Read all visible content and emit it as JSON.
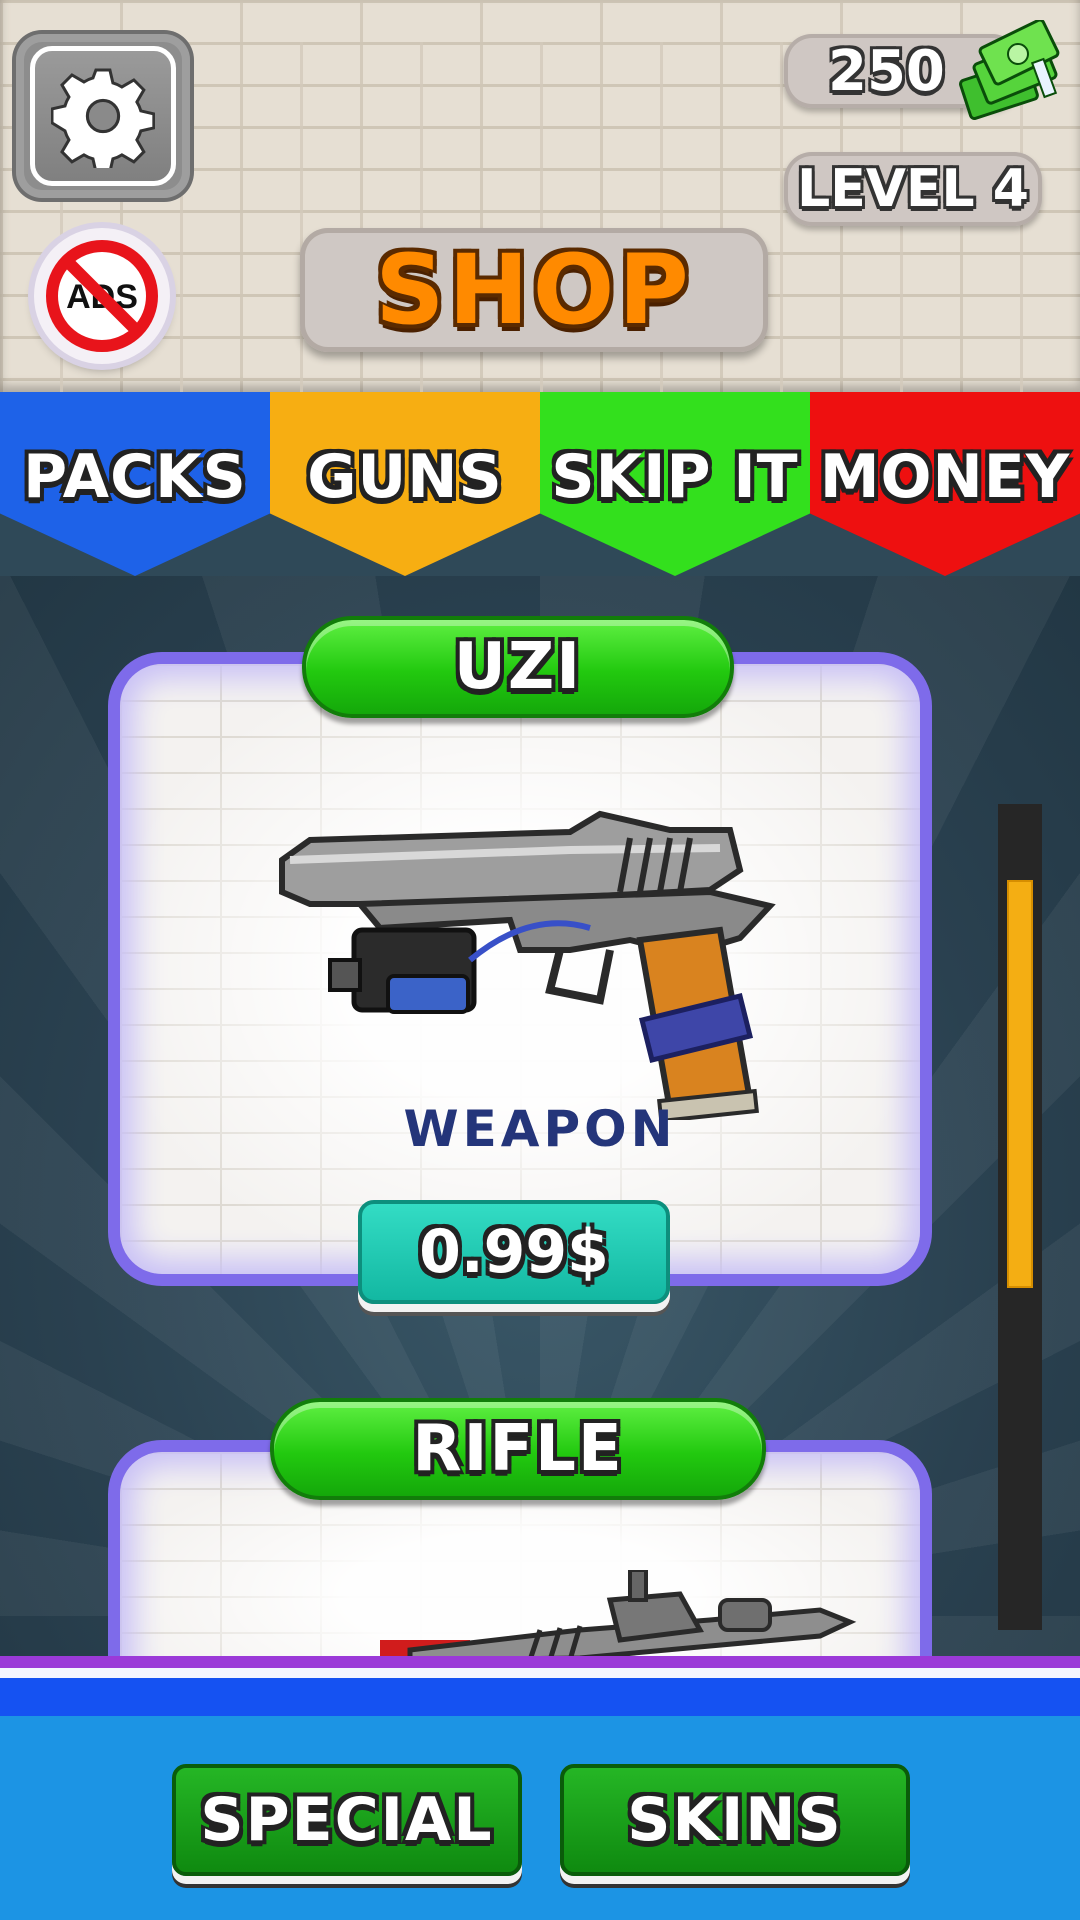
{
  "header": {
    "title": "SHOP",
    "money": "250",
    "level": "LEVEL 4",
    "noads_label": "ADS",
    "icons": [
      "gear-icon",
      "no-ads-icon",
      "cash-stack-icon"
    ]
  },
  "tabs": [
    {
      "label": "PACKS",
      "color": "#1e62e8"
    },
    {
      "label": "GUNS",
      "color": "#f7ae12"
    },
    {
      "label": "SKIP IT",
      "color": "#33e01d"
    },
    {
      "label": "MONEY",
      "color": "#ee1010"
    }
  ],
  "items": [
    {
      "name": "UZI",
      "type": "WEAPON",
      "price": "0.99$"
    },
    {
      "name": "RIFLE"
    }
  ],
  "bottom": {
    "special_label": "SPECIAL",
    "skins_label": "SKINS"
  },
  "colors": {
    "accent_green": "#22c90f",
    "price_teal": "#13b8a2",
    "card_border": "#7e6bea",
    "scroll_thumb": "#f4ae13",
    "bottom_bar": "#1c94e4"
  }
}
